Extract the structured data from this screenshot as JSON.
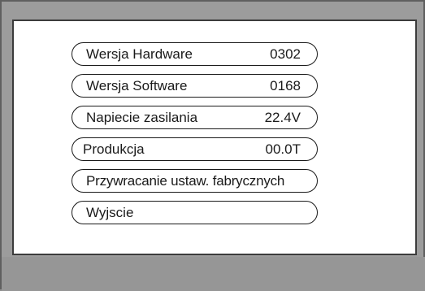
{
  "menu": {
    "items": [
      {
        "label": "Wersja Hardware",
        "value": "0302"
      },
      {
        "label": "Wersja Software",
        "value": "0168"
      },
      {
        "label": "Napiecie zasilania",
        "value": "22.4V"
      },
      {
        "label": "Produkcja",
        "value": "00.0T"
      },
      {
        "label": "Przywracanie ustaw. fabrycznych",
        "value": ""
      },
      {
        "label": "Wyjscie",
        "value": ""
      }
    ]
  },
  "colors": {
    "screen_background": "#ffffff",
    "bezel": "#9c9c9c",
    "text": "#1a1a1a",
    "border": "#1a1a1a"
  }
}
